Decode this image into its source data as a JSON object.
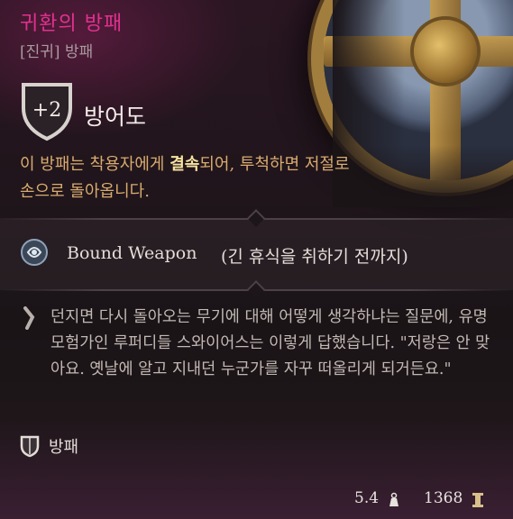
{
  "item": {
    "name": "귀환의 방패",
    "subtitle": "[진귀] 방패",
    "armor_class": "+2",
    "armor_class_label": "방어도",
    "description_pre": "이 방패는 착용자에게 ",
    "description_highlight": "결속",
    "description_post": "되어, 투척하면 저절로 손으로 돌아옵니다.",
    "property": {
      "name": "Bound Weapon",
      "note": "(긴 휴식을 취하기 전까지)",
      "icon": "bound-weapon-icon"
    },
    "flavor_text": "던지면 다시 돌아오는 무기에 대해 어떻게 생각하냐는 질문에, 유명 모험가인 루퍼디들 스와이어스는 이렇게 답했습니다. \"저랑은 안 맞아요. 옛날에 알고 지내던 누군가를 자꾸 떠올리게 되거든요.\"",
    "type": "방패",
    "weight": "5.4",
    "price": "1368"
  },
  "colors": {
    "title": "#e0308f",
    "description": "#d9ab6f",
    "highlight": "#f6e3a0"
  }
}
